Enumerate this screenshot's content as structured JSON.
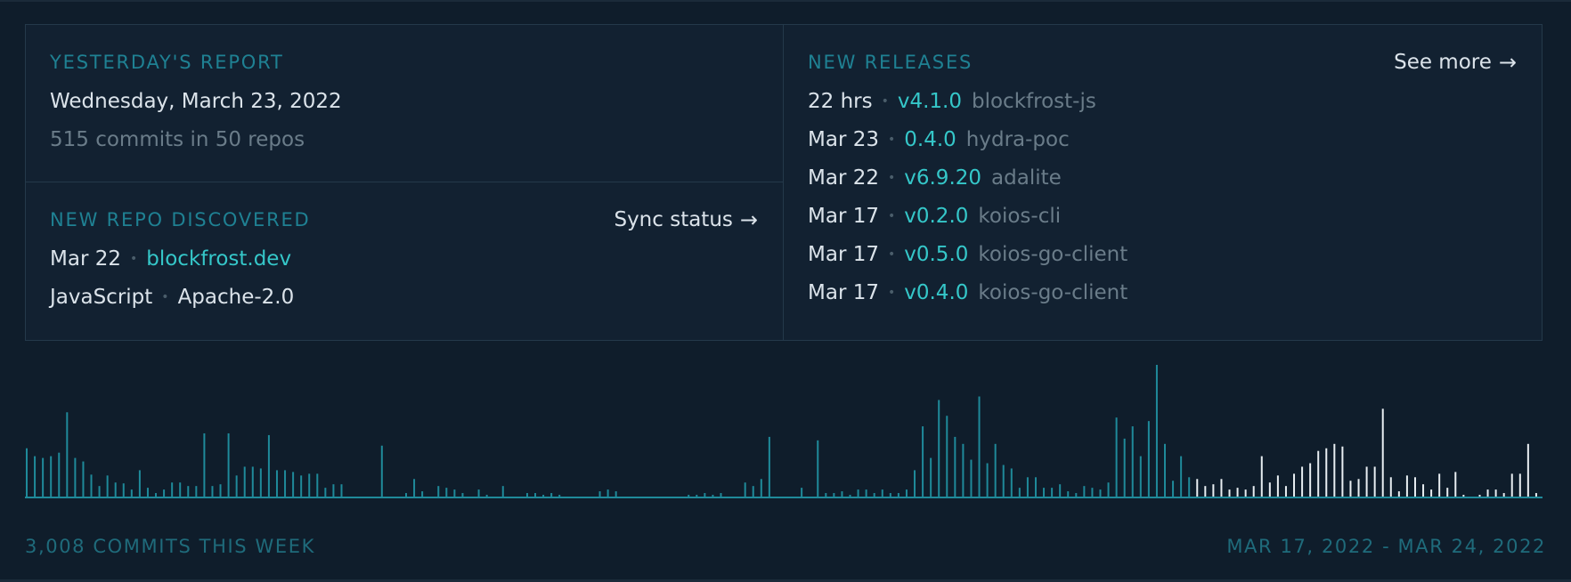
{
  "yesterday": {
    "title": "YESTERDAY'S REPORT",
    "date": "Wednesday, March 23, 2022",
    "summary": "515 commits in 50 repos"
  },
  "new_repo": {
    "title": "NEW REPO DISCOVERED",
    "link": "Sync status",
    "date": "Mar 22",
    "repo": "blockfrost.dev",
    "language": "JavaScript",
    "license": "Apache-2.0"
  },
  "releases": {
    "title": "NEW RELEASES",
    "link": "See more",
    "items": [
      {
        "when": "22 hrs",
        "version": "v4.1.0",
        "repo": "blockfrost-js"
      },
      {
        "when": "Mar 23",
        "version": "0.4.0",
        "repo": "hydra-poc"
      },
      {
        "when": "Mar 22",
        "version": "v6.9.20",
        "repo": "adalite"
      },
      {
        "when": "Mar 17",
        "version": "v0.2.0",
        "repo": "koios-cli"
      },
      {
        "when": "Mar 17",
        "version": "v0.5.0",
        "repo": "koios-go-client"
      },
      {
        "when": "Mar 17",
        "version": "v0.4.0",
        "repo": "koios-go-client"
      }
    ]
  },
  "footer": {
    "commits_week": "3,008 COMMITS THIS WEEK",
    "range": "MAR 17, 2022 - MAR 24, 2022"
  },
  "colors": {
    "bar_past": "#1f8a9a",
    "bar_recent": "#e8eef2",
    "accent": "#35c7c9"
  },
  "chart_data": {
    "type": "bar",
    "title": "",
    "recent_start_index": 145,
    "values": [
      55,
      46,
      44,
      46,
      50,
      96,
      44,
      40,
      25,
      12,
      24,
      16,
      15,
      8,
      30,
      10,
      4,
      8,
      16,
      16,
      12,
      12,
      72,
      12,
      14,
      72,
      24,
      34,
      34,
      32,
      70,
      30,
      30,
      28,
      24,
      26,
      26,
      10,
      14,
      14,
      0,
      0,
      0,
      0,
      58,
      0,
      0,
      4,
      20,
      6,
      0,
      12,
      10,
      8,
      4,
      0,
      8,
      2,
      0,
      12,
      0,
      0,
      4,
      4,
      2,
      4,
      2,
      0,
      0,
      0,
      0,
      6,
      8,
      6,
      0,
      0,
      0,
      0,
      0,
      0,
      0,
      0,
      2,
      2,
      4,
      2,
      4,
      0,
      0,
      16,
      12,
      20,
      68,
      0,
      0,
      0,
      10,
      0,
      64,
      4,
      4,
      6,
      2,
      8,
      8,
      4,
      8,
      4,
      4,
      8,
      30,
      80,
      44,
      110,
      92,
      68,
      60,
      42,
      114,
      38,
      60,
      36,
      32,
      10,
      22,
      22,
      10,
      10,
      14,
      6,
      4,
      12,
      10,
      8,
      16,
      90,
      66,
      80,
      46,
      86,
      150,
      60,
      18,
      46,
      22,
      20,
      12,
      14,
      20,
      8,
      10,
      8,
      12,
      46,
      16,
      24,
      12,
      26,
      34,
      38,
      52,
      55,
      60,
      57,
      18,
      20,
      34,
      34,
      100,
      22,
      6,
      24,
      22,
      14,
      8,
      26,
      10,
      28,
      2,
      0,
      2,
      8,
      8,
      4,
      26,
      26,
      60,
      4
    ]
  }
}
